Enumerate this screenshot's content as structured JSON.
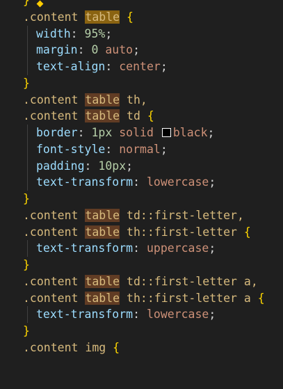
{
  "lines": [
    {
      "brace": "}"
    },
    {
      "sel": ".content",
      "table": "table",
      "rest": "",
      "open": "{"
    },
    {
      "prop": "width",
      "num": "95%",
      "end": ";"
    },
    {
      "prop": "margin",
      "num": "0",
      "val": "auto",
      "end": ";"
    },
    {
      "prop": "text-align",
      "val": "center",
      "end": ";"
    },
    {
      "brace": "}"
    },
    {
      "sel": ".content",
      "table": "table",
      "rest": "th,",
      "open": ""
    },
    {
      "sel": ".content",
      "table": "table",
      "rest": "td",
      "open": "{"
    },
    {
      "prop": "border",
      "num": "1px",
      "val": "solid",
      "swatch_color": "#000000",
      "val2": "black",
      "end": ";"
    },
    {
      "prop": "font-style",
      "val": "normal",
      "end": ";"
    },
    {
      "prop": "padding",
      "num": "10px",
      "end": ";"
    },
    {
      "prop": "text-transform",
      "val": "lowercase",
      "end": ";"
    },
    {
      "brace": "}"
    },
    {
      "sel": ".content",
      "table": "table",
      "rest": "td::first-letter,",
      "open": ""
    },
    {
      "sel": ".content",
      "table": "table",
      "rest": "th::first-letter",
      "open": "{"
    },
    {
      "prop": "text-transform",
      "val": "uppercase",
      "end": ";"
    },
    {
      "brace": "}"
    },
    {
      "sel": ".content",
      "table": "table",
      "rest": "td::first-letter a,",
      "open": ""
    },
    {
      "sel": ".content",
      "table": "table",
      "rest": "th::first-letter a",
      "open": "{"
    },
    {
      "prop": "text-transform",
      "val": "lowercase",
      "end": ";"
    },
    {
      "brace": "}"
    },
    {
      "sel": ".content img",
      "open": "{"
    }
  ],
  "colors": {
    "background": "#1f1f1f",
    "selector": "#d7ba7d",
    "property": "#9cdcfe",
    "number": "#b5cea8",
    "value": "#ce9178",
    "brace": "#ffd700",
    "match_highlight": "#613c24",
    "active_match_highlight": "#8a6311"
  },
  "icons": {
    "lightbulb": "lightbulb-icon"
  }
}
